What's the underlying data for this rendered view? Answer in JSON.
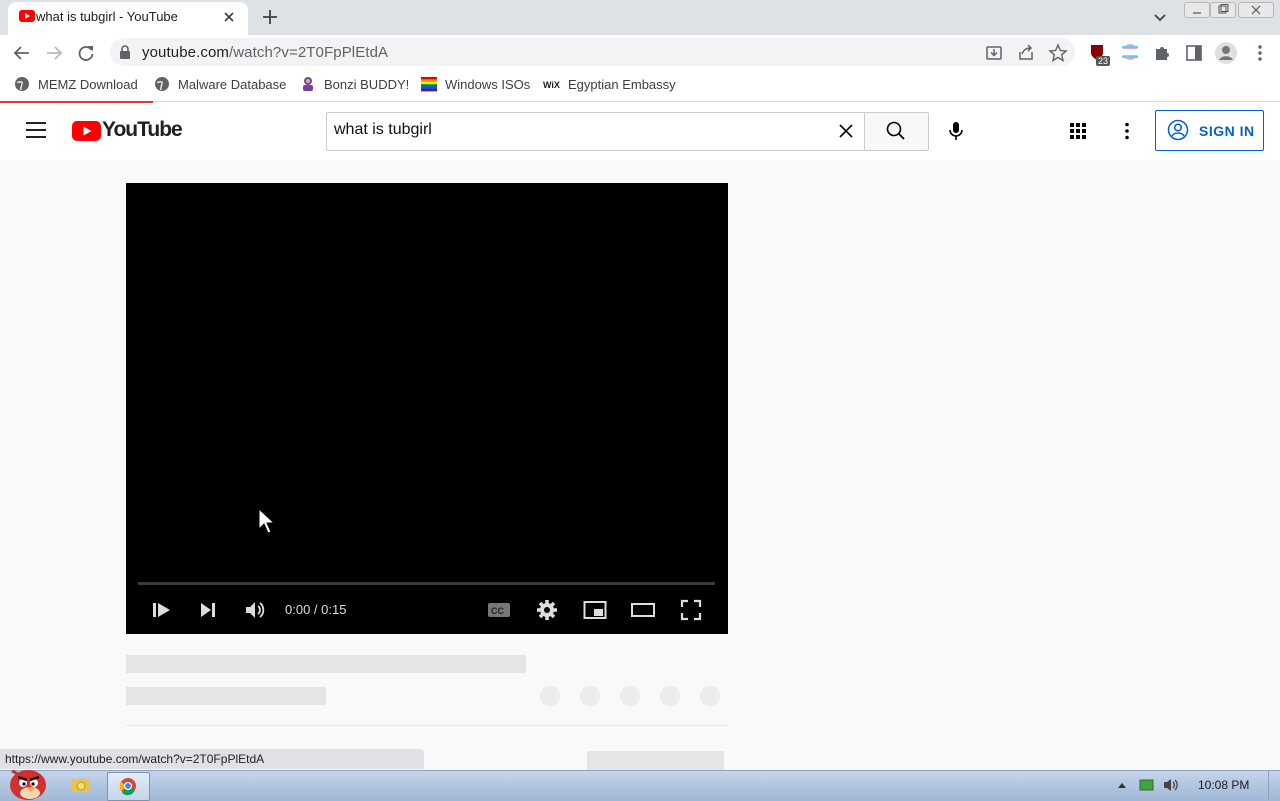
{
  "browser": {
    "tab_title": "what is tubgirl - YouTube",
    "url_host": "youtube.com",
    "url_path": "/watch?v=2T0FpPlEtdA",
    "extension_badge": "23",
    "bookmarks": [
      {
        "label": "MEMZ Download",
        "icon": "globe-icon"
      },
      {
        "label": "Malware Database",
        "icon": "globe-icon"
      },
      {
        "label": "Bonzi BUDDY!",
        "icon": "bonzi-icon"
      },
      {
        "label": "Windows ISOs",
        "icon": "rainbow-flag-icon"
      },
      {
        "label": "Egyptian Embassy",
        "icon": "wix-icon"
      }
    ],
    "status_url": "https://www.youtube.com/watch?v=2T0FpPlEtdA"
  },
  "youtube": {
    "logo_text": "YouTube",
    "search_value": "what is tubgirl",
    "sign_in_label": "SIGN IN",
    "player": {
      "time": "0:00 / 0:15",
      "progress_fraction": 0
    }
  },
  "taskbar": {
    "clock": "10:08 PM"
  },
  "colors": {
    "youtube_red": "#ff0000",
    "link_blue": "#065fd4",
    "player_bg": "#000000"
  }
}
